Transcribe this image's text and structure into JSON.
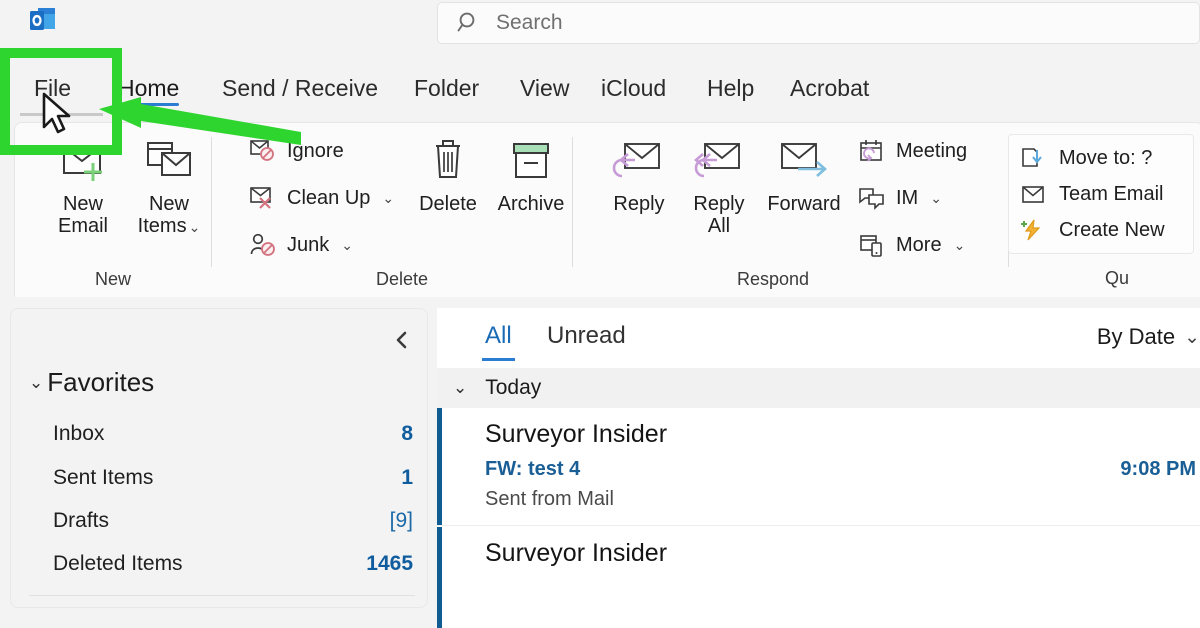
{
  "app": {
    "logo_icon": "outlook-logo"
  },
  "search": {
    "placeholder": "Search",
    "icon": "search-icon"
  },
  "ribbon_tabs": [
    {
      "label": "File",
      "active": false
    },
    {
      "label": "Home",
      "active": true
    },
    {
      "label": "Send / Receive",
      "active": false
    },
    {
      "label": "Folder",
      "active": false
    },
    {
      "label": "View",
      "active": false
    },
    {
      "label": "iCloud",
      "active": false
    },
    {
      "label": "Help",
      "active": false
    },
    {
      "label": "Acrobat",
      "active": false
    }
  ],
  "ribbon": {
    "groups": {
      "new": {
        "label": "New",
        "new_email": "New\nEmail",
        "new_email_line1": "New",
        "new_email_line2": "Email",
        "new_items_line1": "New",
        "new_items_line2": "Items"
      },
      "delete": {
        "label": "Delete",
        "ignore": "Ignore",
        "clean_up": "Clean Up",
        "junk": "Junk",
        "delete": "Delete",
        "archive": "Archive"
      },
      "respond": {
        "label": "Respond",
        "reply": "Reply",
        "reply_all_line1": "Reply",
        "reply_all_line2": "All",
        "forward": "Forward",
        "meeting": "Meeting",
        "im": "IM",
        "more": "More"
      },
      "quick_steps": {
        "label": "Qu",
        "move_to": "Move to: ?",
        "team_email": "Team Email",
        "create_new": "Create New"
      }
    }
  },
  "sidebar": {
    "collapse_icon": "chevron-left-icon",
    "favorites_label": "Favorites",
    "items": [
      {
        "label": "Inbox",
        "count": "8",
        "dim": false
      },
      {
        "label": "Sent Items",
        "count": "1",
        "dim": false
      },
      {
        "label": "Drafts",
        "count": "[9]",
        "dim": true
      },
      {
        "label": "Deleted Items",
        "count": "1465",
        "dim": false
      }
    ]
  },
  "message_list": {
    "tabs": [
      {
        "label": "All",
        "active": true
      },
      {
        "label": "Unread",
        "active": false
      }
    ],
    "sort_by": "By Date",
    "group_header": "Today",
    "messages": [
      {
        "from": "Surveyor Insider",
        "subject": "FW: test 4",
        "preview": "Sent from Mail",
        "time": "9:08 PM"
      },
      {
        "from": "Surveyor Insider",
        "subject": "",
        "preview": "",
        "time": ""
      }
    ]
  },
  "annotation": {
    "highlight_color": "#2fd52f",
    "target": "File",
    "arrow_icon": "left-arrow-annotation",
    "cursor_icon": "mouse-pointer-icon"
  }
}
